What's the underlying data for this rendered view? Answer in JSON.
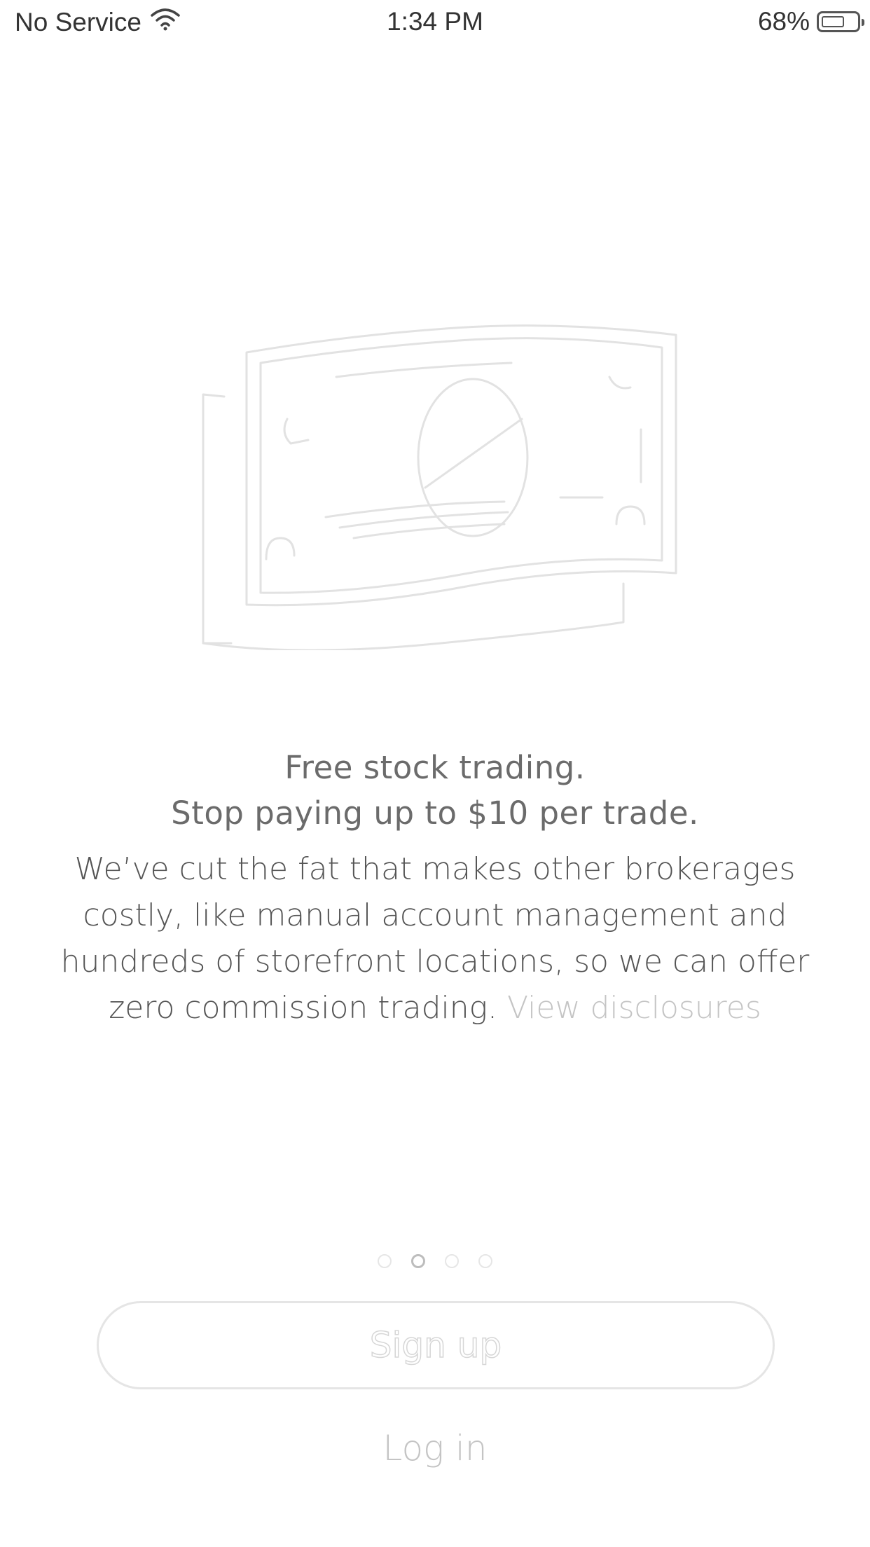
{
  "status_bar": {
    "carrier": "No Service",
    "time": "1:34 PM",
    "battery": "68%",
    "wifi_icon": "wifi-icon",
    "battery_icon": "battery-icon"
  },
  "illustration": {
    "icon": "dollar-bill-icon"
  },
  "onboarding": {
    "headline_line1": "Free stock trading.",
    "headline_line2": "Stop paying up to $10 per trade.",
    "body": "We’ve cut the fat that makes other brokerages costly, like manual account management and hundreds of storefront locations, so we can offer zero commission trading.",
    "disclosures_link": "View disclosures"
  },
  "pager": {
    "total": 4,
    "active_index": 1
  },
  "actions": {
    "signup_label": "Sign up",
    "login_label": "Log in"
  }
}
